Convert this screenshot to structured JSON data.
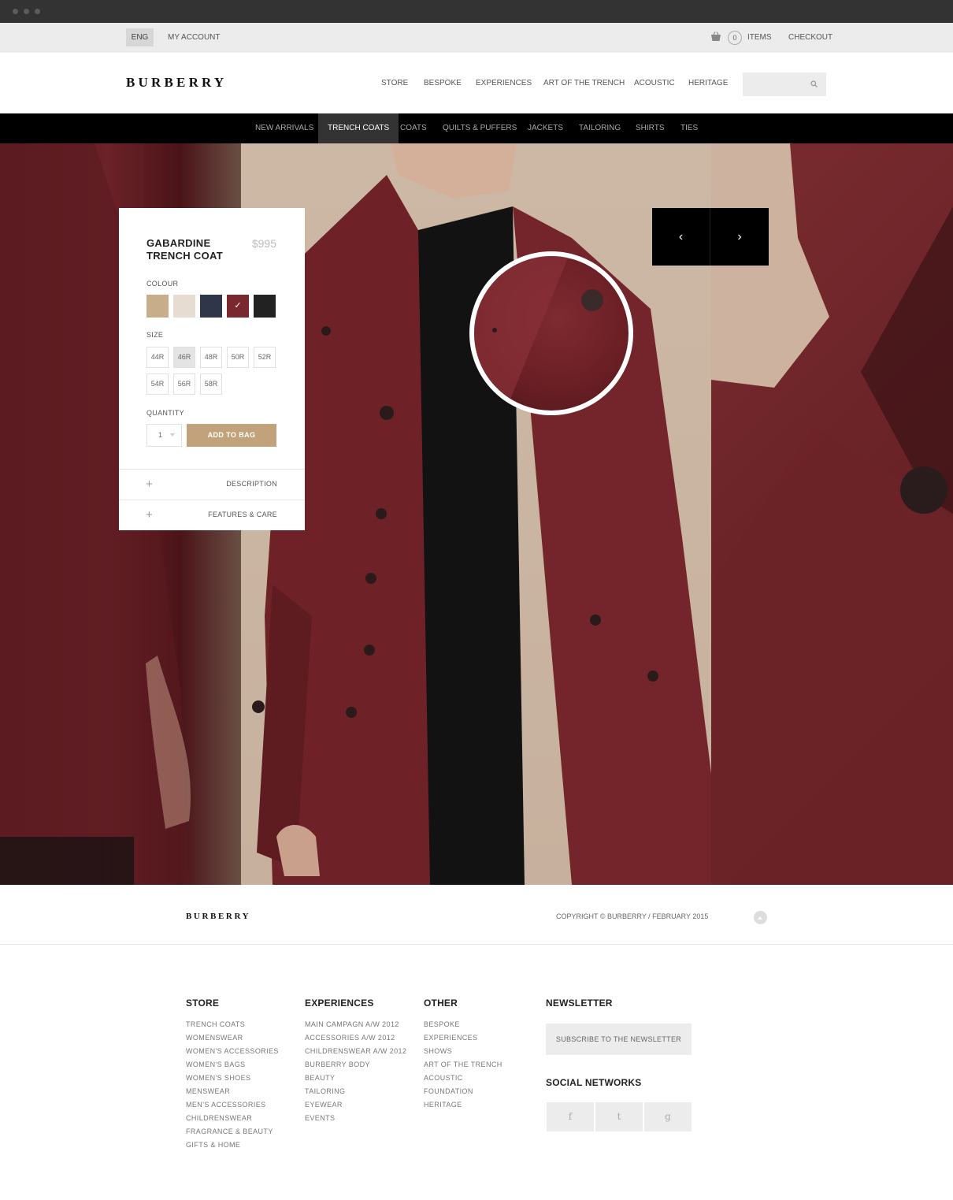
{
  "topbar": {
    "lang": "ENG",
    "account": "MY ACCOUNT",
    "cart_count": "0",
    "cart_items": "ITEMS",
    "checkout": "CHECKOUT"
  },
  "header": {
    "logo": "BURBERRY",
    "nav": [
      "STORE",
      "BESPOKE",
      "EXPERIENCES",
      "ART OF THE TRENCH",
      "ACOUSTIC",
      "HERITAGE"
    ]
  },
  "categories": {
    "items": [
      "NEW ARRIVALS",
      "TRENCH COATS",
      "COATS",
      "QUILTS & PUFFERS",
      "JACKETS",
      "TAILORING",
      "SHIRTS",
      "TIES"
    ],
    "active": "TRENCH COATS"
  },
  "product": {
    "title_line1": "GABARDINE",
    "title_line2": "TRENCH COAT",
    "price": "$995",
    "colour_label": "COLOUR",
    "colours": [
      {
        "hex": "#c8ad8a"
      },
      {
        "hex": "#e7dcd1"
      },
      {
        "hex": "#2f364a"
      },
      {
        "hex": "#7a2830",
        "selected": true
      },
      {
        "hex": "#222222"
      }
    ],
    "check": "✓",
    "size_label": "SIZE",
    "sizes_row1": [
      "44R",
      "46R",
      "48R",
      "50R",
      "52R"
    ],
    "sizes_row2": [
      "54R",
      "56R",
      "58R"
    ],
    "selected_size": "46R",
    "quantity_label": "QUANTITY",
    "quantity": "1",
    "add_to_bag": "ADD TO BAG",
    "description": "DESCRIPTION",
    "features": "FEATURES & CARE",
    "plus": "+"
  },
  "slider": {
    "prev": "‹",
    "next": "›"
  },
  "footer": {
    "logo": "BURBERRY",
    "copyright": "COPYRIGHT © BURBERRY / FEBRUARY 2015",
    "store_title": "STORE",
    "store_links": [
      "TRENCH COATS",
      "WOMENSWEAR",
      "WOMEN'S ACCESSORIES",
      "WOMEN'S BAGS",
      "WOMEN'S SHOES",
      "MENSWEAR",
      "MEN'S ACCESSORIES",
      "CHILDRENSWEAR",
      "FRAGRANCE & BEAUTY",
      "GIFTS & HOME"
    ],
    "experiences_title": "EXPERIENCES",
    "experiences_links": [
      "MAIN CAMPAGN A/W 2012",
      "ACCESSORIES A/W 2012",
      "CHILDRENSWEAR A/W 2012",
      "BURBERRY BODY",
      "BEAUTY",
      "TAILORING",
      "EYEWEAR",
      "EVENTS"
    ],
    "other_title": "OTHER",
    "other_links": [
      "BESPOKE",
      "EXPERIENCES",
      "SHOWS",
      "ART OF THE TRENCH",
      "ACOUSTIC",
      "FOUNDATION",
      "HERITAGE"
    ],
    "newsletter_title": "NEWSLETTER",
    "subscribe": "SUBSCRIBE TO THE NEWSLETTER",
    "social_title": "SOCIAL NETWORKS",
    "social": [
      "f",
      "t",
      "g"
    ]
  },
  "colors": {
    "accent": "#c2a27a",
    "coat": "#7a2830"
  }
}
